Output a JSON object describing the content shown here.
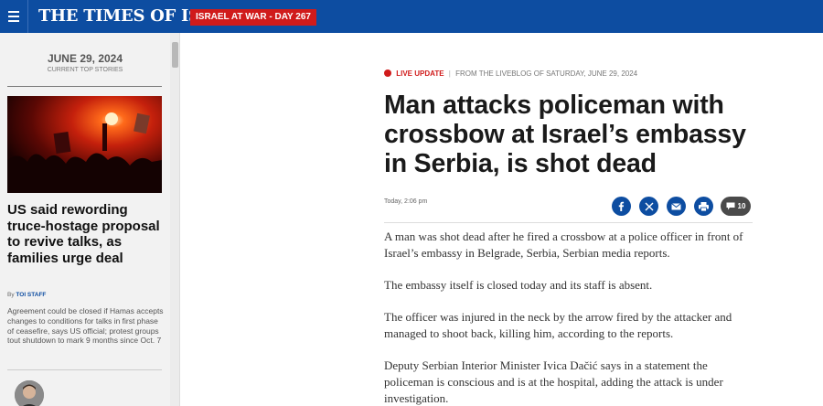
{
  "header": {
    "logo_text": "THE TIMES OF ISRAEL",
    "war_badge": "ISRAEL AT WAR - DAY 267",
    "brand_color": "#0d4da1",
    "badge_color": "#d01b1b"
  },
  "sidebar": {
    "date": "JUNE 29, 2024",
    "subtitle": "CURRENT TOP STORIES",
    "story": {
      "headline": "US said rewording truce-hostage proposal to revive talks, as families urge deal",
      "byline_prefix": "By",
      "byline_author": "TOI STAFF",
      "summary": "Agreement could be closed if Hamas accepts changes to conditions for talks in first phase of ceasefire, says US official; protest groups tout shutdown to mark 9 months since Oct. 7"
    }
  },
  "article": {
    "live_label": "LIVE UPDATE",
    "source": "FROM THE LIVEBLOG OF SATURDAY, JUNE 29, 2024",
    "title": "Man attacks policeman with crossbow at Israel’s embassy in Serbia, is shot dead",
    "timestamp": "Today, 2:06 pm",
    "share_icons": [
      "facebook-icon",
      "x-icon",
      "email-icon",
      "print-icon"
    ],
    "comment_count": "10",
    "paragraphs": [
      "A man was shot dead after he fired a crossbow at a police officer in front of Israel’s embassy in Belgrade, Serbia, Serbian media reports.",
      "The embassy itself is closed today and its staff is absent.",
      "The officer was injured in the neck by the arrow fired by the attacker and managed to shoot back, killing him, according to the reports.",
      "Deputy Serbian Interior Minister Ivica Dačić says in a statement the policeman is conscious and is at the hospital, adding the attack is under investigation."
    ]
  }
}
